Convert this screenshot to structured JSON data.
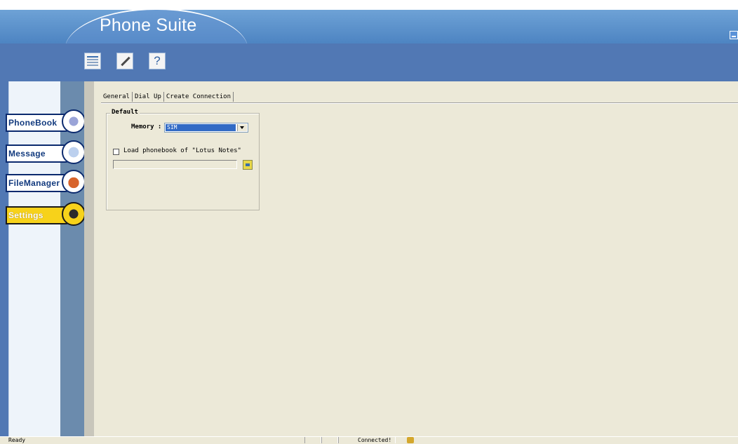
{
  "app": {
    "title": "Phone Suite"
  },
  "toolbar": {
    "buttons": [
      {
        "icon": "document-icon"
      },
      {
        "icon": "edit-icon"
      },
      {
        "icon": "help-icon",
        "label": "?"
      }
    ]
  },
  "sidebar": {
    "items": [
      {
        "label": "PhoneBook",
        "icon": "phonebook-icon",
        "active": false
      },
      {
        "label": "Message",
        "icon": "message-icon",
        "active": false
      },
      {
        "label": "FileManager",
        "icon": "filemanager-icon",
        "active": false
      },
      {
        "label": "Settings",
        "icon": "settings-icon",
        "active": true
      }
    ]
  },
  "tabs": [
    {
      "label": "General",
      "active": true
    },
    {
      "label": "Dial Up",
      "active": false
    },
    {
      "label": "Create Connection",
      "active": false
    }
  ],
  "general": {
    "group_title": "Default",
    "memory_label": "Memory :",
    "memory_value": "SIM",
    "lotus_label": "Load phonebook of \"Lotus Notes\"",
    "lotus_checked": false,
    "lotus_path": ""
  },
  "status": {
    "left": "Ready",
    "connection": "Connected!"
  },
  "colors": {
    "toolbar": "#5178b4",
    "active_nav": "#f7d21a",
    "selection": "#316ac5"
  }
}
